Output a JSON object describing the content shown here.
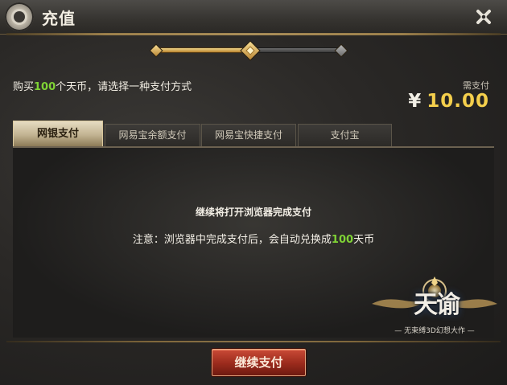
{
  "window": {
    "title": "充值"
  },
  "steps": {
    "total": 3,
    "current": 2
  },
  "prompt": {
    "before": "购买",
    "amount": "100",
    "after": "个天币，请选择一种支付方式"
  },
  "payment": {
    "label": "需支付",
    "currency_symbol": "¥",
    "amount": "10.00"
  },
  "tabs": [
    {
      "label": "网银支付",
      "active": true
    },
    {
      "label": "网易宝余额支付",
      "active": false
    },
    {
      "label": "网易宝快捷支付",
      "active": false
    },
    {
      "label": "支付宝",
      "active": false
    }
  ],
  "panel": {
    "message_main": "继续将打开浏览器完成支付",
    "note_before": "注意：浏览器中完成支付后，会自动兑换成",
    "note_amount": "100",
    "note_after": "天币"
  },
  "logo": {
    "title": "天谕",
    "subtitle": "— 无束缚3D幻想大作 —"
  },
  "footer": {
    "continue_label": "继续支付"
  },
  "colors": {
    "highlight_green": "#7fd335",
    "price_gold": "#f4cf4c",
    "button_red": "#9a2a1c"
  },
  "icons": {
    "title": "gear-icon",
    "close": "close-icon"
  }
}
